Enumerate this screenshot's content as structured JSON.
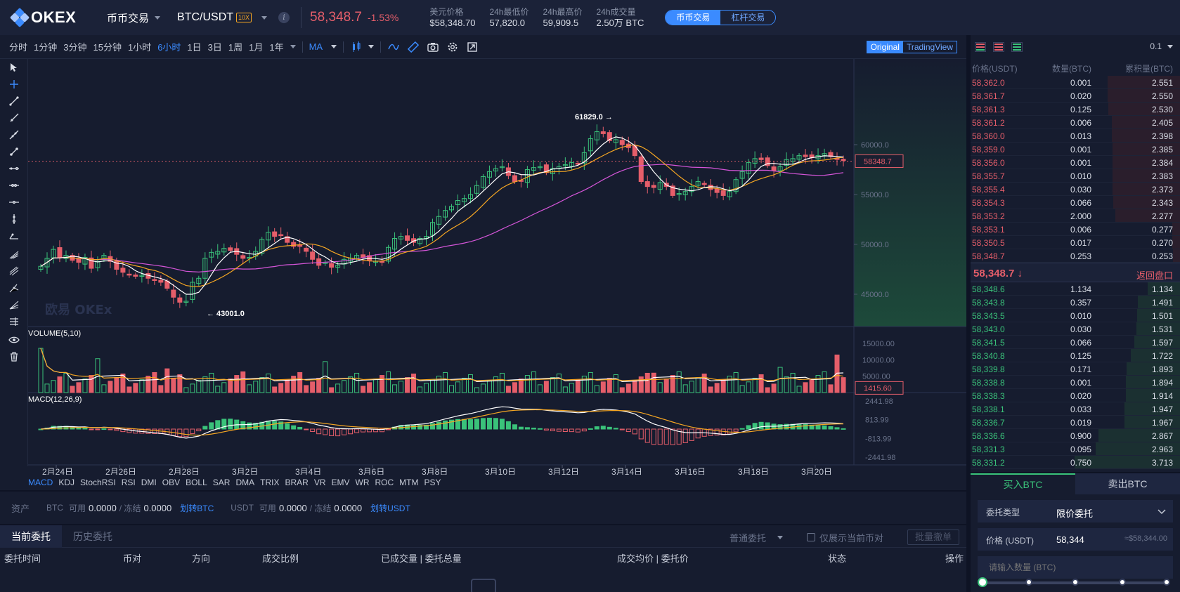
{
  "header": {
    "logo": "OKEX",
    "market_menu": "币币交易",
    "pair": "BTC/USDT",
    "leverage_badge": "10X",
    "info_icon": "i",
    "last_price": "58,348.7",
    "change": "-1.53%",
    "stats": [
      {
        "label": "美元价格",
        "value": "$58,348.70"
      },
      {
        "label": "24h最低价",
        "value": "57,820.0"
      },
      {
        "label": "24h最高价",
        "value": "59,909.5"
      },
      {
        "label": "24h成交量",
        "value": "2.50万 BTC"
      }
    ],
    "mode_tabs": [
      "币币交易",
      "杠杆交易"
    ]
  },
  "toolbar": {
    "timeframes": [
      "分时",
      "1分钟",
      "3分钟",
      "15分钟",
      "1小时",
      "6小时",
      "1日",
      "3日",
      "1周",
      "1月",
      "1年"
    ],
    "active_timeframe": "6小时",
    "indicator_select": "MA",
    "view_tabs": [
      "Original",
      "TradingView"
    ],
    "icons": [
      "candle-type-icon",
      "line-icon",
      "ruler-icon",
      "camera-icon",
      "settings-icon",
      "fullscreen-icon"
    ]
  },
  "draw_tools": [
    "cursor-icon",
    "crosshair-icon",
    "trend-line-icon",
    "ray-icon",
    "extended-line-icon",
    "parallel-channel-icon",
    "horizontal-line-icon",
    "horizontal-ray-icon",
    "price-range-icon",
    "vertical-line-icon",
    "arrow-line-icon",
    "pitchfork-icon",
    "fib-retracement-icon",
    "fib-extension-icon",
    "fib-fan-icon",
    "gann-icon",
    "visibility-icon",
    "trash-icon"
  ],
  "chart": {
    "watermark": "欧易 OKEx",
    "price_ticks": [
      "60000.0",
      "55000.0",
      "50000.0",
      "45000.0"
    ],
    "current_price_label": "58348.7",
    "high_label": "61829.0",
    "low_label": "43001.0",
    "volume_title": "VOLUME(5,10)",
    "volume_ticks": [
      "15000.00",
      "10000.00",
      "5000.00"
    ],
    "volume_current": "1415.60",
    "macd_title": "MACD(12,26,9)",
    "macd_ticks": [
      "2441.98",
      "813.99",
      "-813.99",
      "-2441.98"
    ],
    "date_ticks": [
      "2月24日",
      "2月26日",
      "2月28日",
      "3月2日",
      "3月4日",
      "3月6日",
      "3月8日",
      "3月10日",
      "3月12日",
      "3月14日",
      "3月16日",
      "3月18日",
      "3月20日"
    ],
    "colors": {
      "up": "#3ac27a",
      "down": "#e55e6a",
      "ma_fast": "#ffffff",
      "ma_mid": "#f5a623",
      "ma_slow": "#d455d8"
    }
  },
  "indicators": [
    "MACD",
    "KDJ",
    "StochRSI",
    "RSI",
    "DMI",
    "OBV",
    "BOLL",
    "SAR",
    "DMA",
    "TRIX",
    "BRAR",
    "VR",
    "EMV",
    "WR",
    "ROC",
    "MTM",
    "PSY"
  ],
  "active_indicator": "MACD",
  "assets": {
    "title": "资产",
    "btc_label": "BTC",
    "usdt_label": "USDT",
    "available": "可用",
    "frozen": "/ 冻结",
    "btc_available": "0.0000",
    "btc_frozen": "0.0000",
    "usdt_available": "0.0000",
    "usdt_frozen": "0.0000",
    "transfer_btc": "划转BTC",
    "transfer_usdt": "划转USDT"
  },
  "orders": {
    "tabs": [
      "当前委托",
      "历史委托"
    ],
    "order_type": "普通委托",
    "only_current": "仅展示当前币对",
    "batch_cancel": "批量撤单",
    "columns": [
      "委托时间",
      "币对",
      "方向",
      "成交比例",
      "已成交量 | 委托总量",
      "成交均价 | 委托价",
      "状态",
      "操作"
    ]
  },
  "orderbook": {
    "precision": "0.1",
    "columns": [
      "价格(USDT)",
      "数量(BTC)",
      "累积量(BTC)"
    ],
    "asks": [
      [
        "58,362.0",
        "0.001",
        "2.551"
      ],
      [
        "58,361.7",
        "0.020",
        "2.550"
      ],
      [
        "58,361.3",
        "0.125",
        "2.530"
      ],
      [
        "58,361.2",
        "0.006",
        "2.405"
      ],
      [
        "58,360.0",
        "0.013",
        "2.398"
      ],
      [
        "58,359.0",
        "0.001",
        "2.385"
      ],
      [
        "58,356.0",
        "0.001",
        "2.384"
      ],
      [
        "58,355.7",
        "0.010",
        "2.383"
      ],
      [
        "58,355.4",
        "0.030",
        "2.373"
      ],
      [
        "58,354.3",
        "0.066",
        "2.343"
      ],
      [
        "58,353.2",
        "2.000",
        "2.277"
      ],
      [
        "58,353.1",
        "0.006",
        "0.277"
      ],
      [
        "58,350.5",
        "0.017",
        "0.270"
      ],
      [
        "58,348.7",
        "0.253",
        "0.253"
      ]
    ],
    "mid_price": "58,348.7 ↓",
    "back_label": "返回盘口",
    "bids": [
      [
        "58,348.6",
        "1.134",
        "1.134"
      ],
      [
        "58,343.8",
        "0.357",
        "1.491"
      ],
      [
        "58,343.5",
        "0.010",
        "1.501"
      ],
      [
        "58,343.0",
        "0.030",
        "1.531"
      ],
      [
        "58,341.5",
        "0.066",
        "1.597"
      ],
      [
        "58,340.8",
        "0.125",
        "1.722"
      ],
      [
        "58,339.8",
        "0.171",
        "1.893"
      ],
      [
        "58,338.8",
        "0.001",
        "1.894"
      ],
      [
        "58,338.3",
        "0.020",
        "1.914"
      ],
      [
        "58,338.1",
        "0.033",
        "1.947"
      ],
      [
        "58,336.7",
        "0.019",
        "1.967"
      ],
      [
        "58,336.6",
        "0.900",
        "2.867"
      ],
      [
        "58,331.3",
        "0.095",
        "2.963"
      ],
      [
        "58,331.2",
        "0.750",
        "3.713"
      ]
    ]
  },
  "trade": {
    "tabs": [
      "买入BTC",
      "卖出BTC"
    ],
    "order_type_label": "委托类型",
    "order_type_value": "限价委托",
    "price_label": "价格 (USDT)",
    "price_value": "58,344",
    "price_usd": "≈$58,344.00",
    "amount_placeholder": "请输入数量 (BTC)"
  }
}
